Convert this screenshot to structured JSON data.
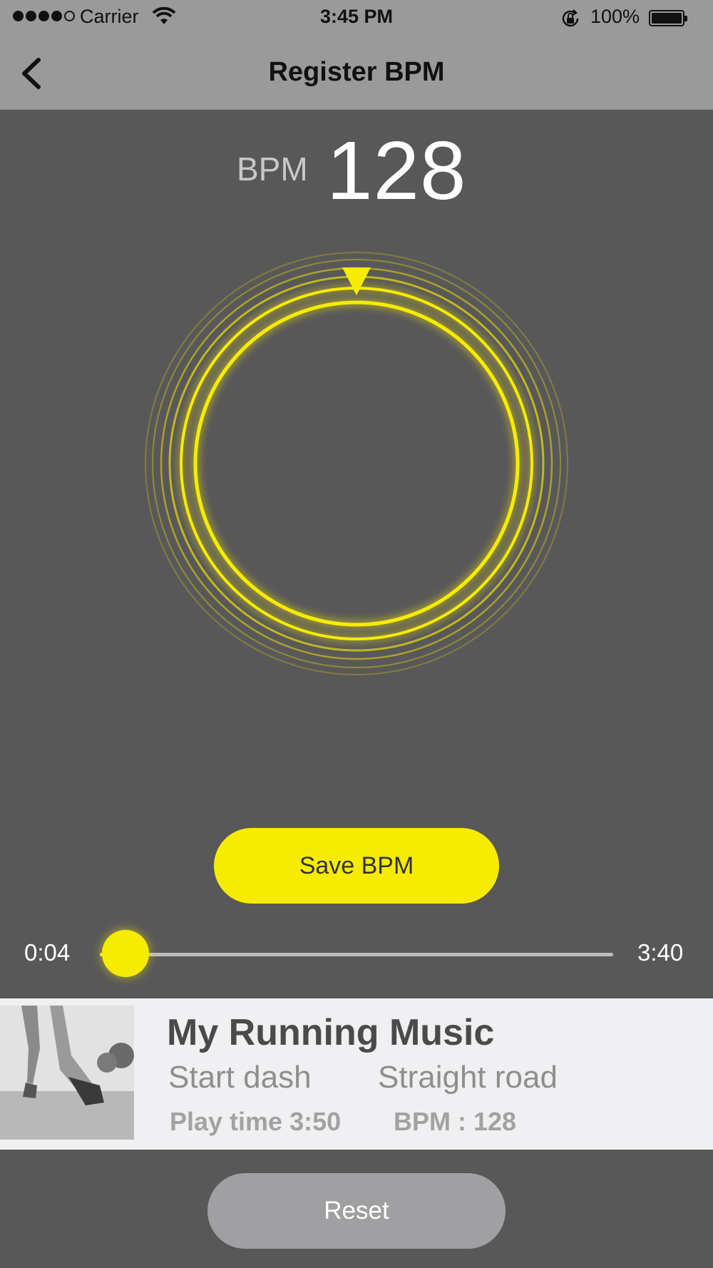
{
  "status_bar": {
    "carrier": "Carrier",
    "time": "3:45 PM",
    "battery": "100%",
    "signal_icon": "signal-dots-icon",
    "wifi_icon": "wifi-icon",
    "lock_icon": "rotation-lock-icon",
    "battery_icon": "battery-icon"
  },
  "nav": {
    "title": "Register BPM",
    "back_icon": "chevron-left-icon"
  },
  "bpm": {
    "label": "BPM",
    "value": "128"
  },
  "ring": {
    "color": "#f7ec00",
    "marker_icon": "triangle-down-icon"
  },
  "save_button": {
    "label": "Save BPM"
  },
  "playback": {
    "current": "0:04",
    "total": "3:40",
    "progress": 0.018
  },
  "track": {
    "title": "My Running Music",
    "tag1": "Start dash",
    "tag2": "Straight road",
    "play_time": "Play time 3:50",
    "bpm": "BPM : 128"
  },
  "reset_button": {
    "label": "Reset"
  },
  "colors": {
    "accent": "#f7ec00",
    "background": "#595859",
    "nav_bar": "#9a9a9a"
  }
}
